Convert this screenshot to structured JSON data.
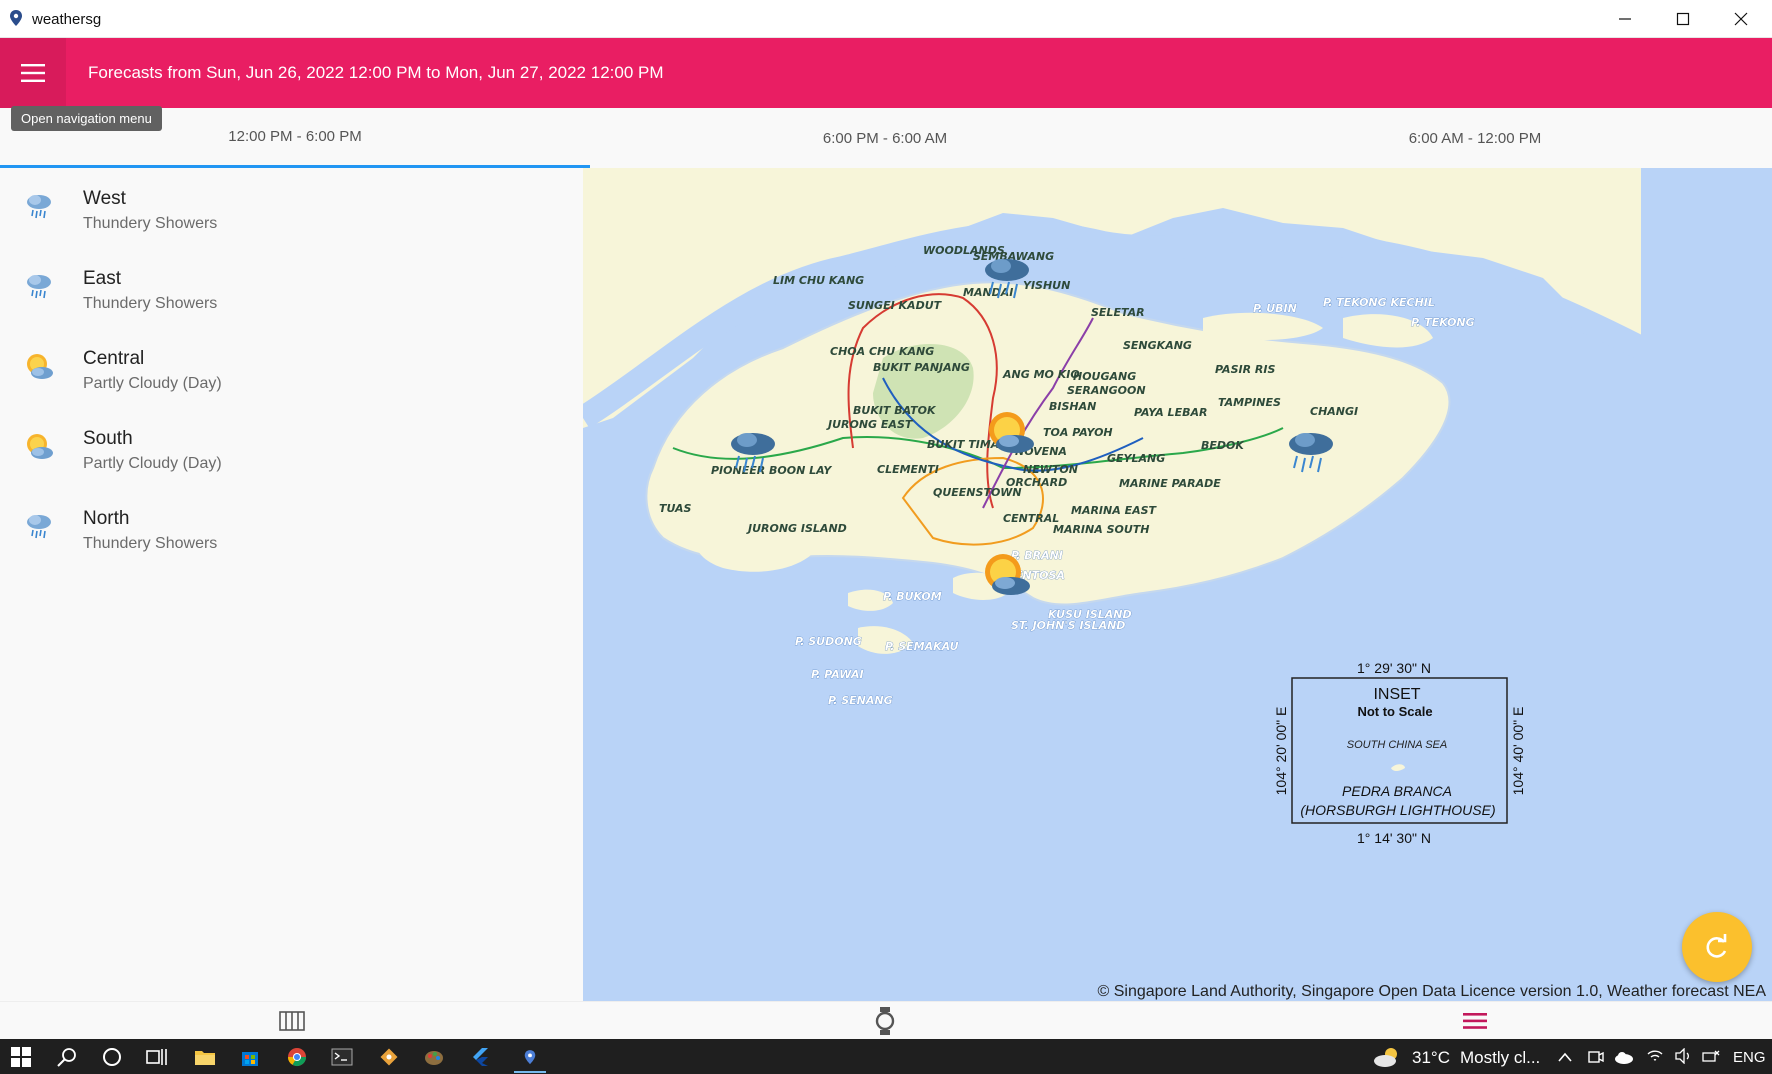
{
  "window": {
    "title": "weathersg"
  },
  "header": {
    "menu_tooltip": "Open navigation menu",
    "heading": "Forecasts from Sun, Jun 26, 2022 12:00 PM to Mon, Jun 27, 2022 12:00 PM"
  },
  "tabs": [
    {
      "label": "12:00 PM - 6:00 PM",
      "active": true
    },
    {
      "label": "6:00 PM - 6:00 AM",
      "active": false
    },
    {
      "label": "6:00 AM - 12:00 PM",
      "active": false
    }
  ],
  "regions": [
    {
      "name": "West",
      "forecast": "Thundery Showers",
      "icon": "thundery-showers-icon"
    },
    {
      "name": "East",
      "forecast": "Thundery Showers",
      "icon": "thundery-showers-icon"
    },
    {
      "name": "Central",
      "forecast": "Partly Cloudy (Day)",
      "icon": "partly-cloudy-day-icon"
    },
    {
      "name": "South",
      "forecast": "Partly Cloudy (Day)",
      "icon": "partly-cloudy-day-icon"
    },
    {
      "name": "North",
      "forecast": "Thundery Showers",
      "icon": "thundery-showers-icon"
    }
  ],
  "map": {
    "labels": {
      "lim_chu_kang": "LIM CHU KANG",
      "woodlands": "WOODLANDS",
      "sembawang": "SEMBAWANG",
      "mandai": "MANDAI",
      "yishun": "YISHUN",
      "sungei_kadut": "SUNGEI KADUT",
      "seletar": "SELETAR",
      "p_ubin": "P. UBIN",
      "p_tekong_kechil": "P. TEKONG KECHIL",
      "p_tekong": "P. TEKONG",
      "sengkang": "SENGKANG",
      "choa_chu_kang": "CHOA CHU KANG",
      "bukit_panjang": "BUKIT PANJANG",
      "ang_mo_kio": "ANG MO KIO",
      "hougang": "HOUGANG",
      "pasir_ris": "PASIR RIS",
      "serangoon": "SERANGOON",
      "bukit_batok": "BUKIT BATOK",
      "bishan": "BISHAN",
      "paya_lebar": "PAYA LEBAR",
      "tampines": "TAMPINES",
      "changi": "CHANGI",
      "jurong_east": "JURONG EAST",
      "toa_payoh": "TOA PAYOH",
      "bukit_timah": "BUKIT TIMAH",
      "novena": "NOVENA",
      "bedok": "BEDOK",
      "geylang": "GEYLANG",
      "pioneer_boon_lay": "PIONEER BOON LAY",
      "clementi": "CLEMENTI",
      "newton": "NEWTON",
      "orchard": "ORCHARD",
      "marine_parade": "MARINE PARADE",
      "queenstown": "QUEENSTOWN",
      "tuas": "TUAS",
      "marina_east": "MARINA EAST",
      "jurong_island": "JURONG ISLAND",
      "central": "CENTRAL",
      "marina_south": "MARINA SOUTH",
      "p_brani": "P. BRANI",
      "sentosa": "SENTOSA",
      "p_bukom": "P. BUKOM",
      "kusu_island": "KUSU ISLAND",
      "st_johns_island": "ST. JOHN'S ISLAND",
      "p_sudong": "P. SUDONG",
      "p_semakau": "P. SEMAKAU",
      "p_pawai": "P. PAWAI",
      "p_senang": "P. SENANG"
    },
    "inset": {
      "top_lat": "1° 29' 30\" N",
      "bottom_lat": "1° 14' 30\" N",
      "left_lon": "104° 20' 00\" E",
      "right_lon": "104° 40' 00\" E",
      "title": "INSET",
      "scale_note": "Not to Scale",
      "sea": "SOUTH CHINA SEA",
      "island": "PEDRA BRANCA",
      "lighthouse": "(HORSBURGH LIGHTHOUSE)"
    },
    "copyright": "© Singapore Land Authority, Singapore Open Data Licence version 1.0, Weather forecast NEA"
  },
  "taskbar": {
    "weather": "31°C",
    "weather_desc": "Mostly cl...",
    "language": "ENG"
  },
  "colors": {
    "header": "#e91e63",
    "tab_indicator": "#2196f3",
    "fab": "#fbc02d",
    "map_sea": "#b9d3f7",
    "map_land": "#f7f5d9"
  }
}
